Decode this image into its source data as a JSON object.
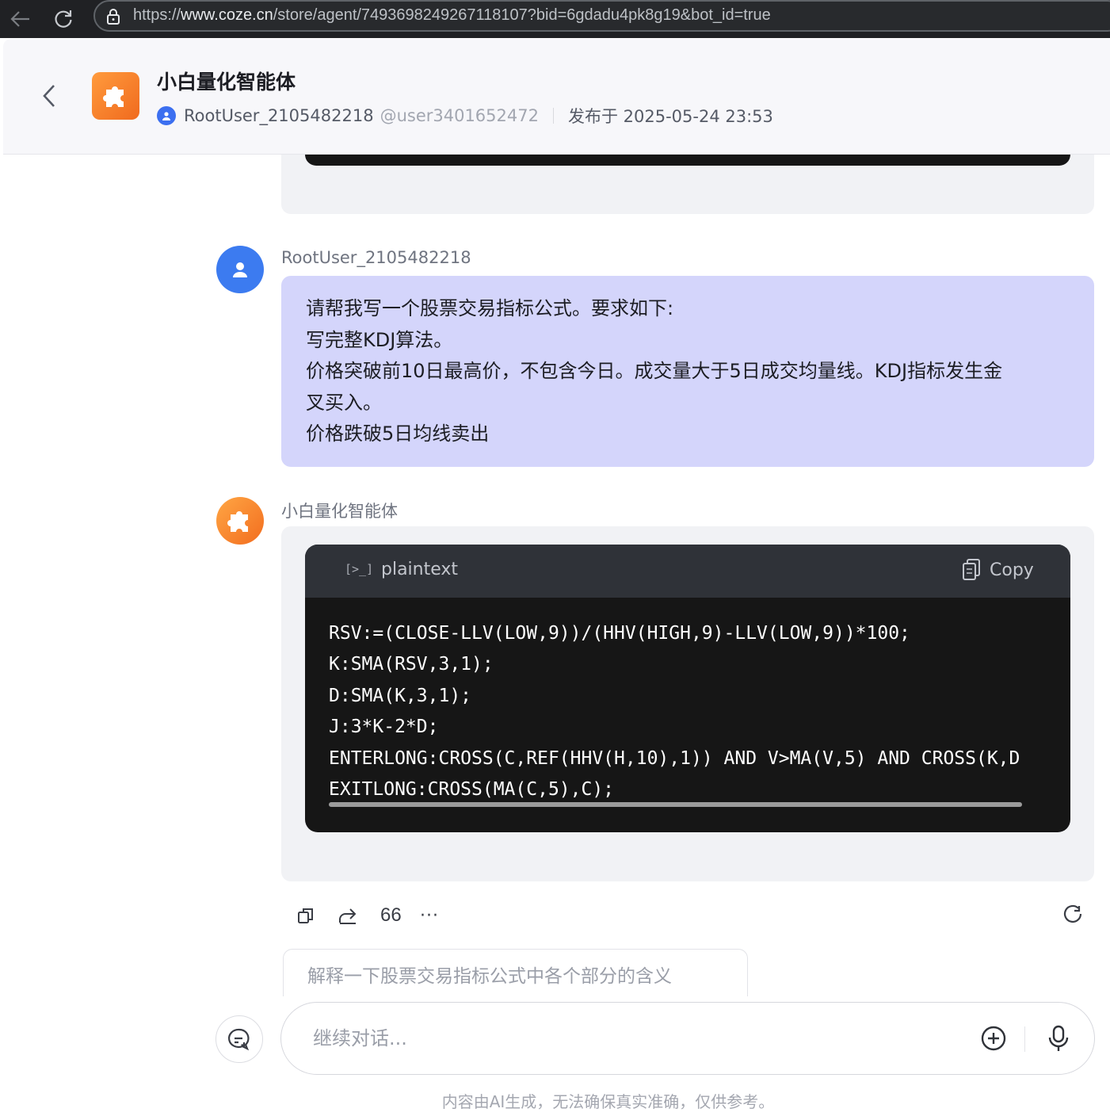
{
  "browser": {
    "url_prefix": "https://",
    "url_host": "www.coze.cn",
    "url_path": "/store/agent/7493698249267118107?bid=6gdadu4pk8g19&bot_id=true"
  },
  "header": {
    "bot_name": "小白量化智能体",
    "author": "RootUser_2105482218",
    "handle": "@user3401652472",
    "published": "发布于 2025-05-24 23:53"
  },
  "messages": {
    "user": {
      "sender": "RootUser_2105482218",
      "lines": [
        "请帮我写一个股票交易指标公式。要求如下:",
        "写完整KDJ算法。",
        "价格突破前10日最高价，不包含今日。成交量大于5日成交均量线。KDJ指标发生金",
        "叉买入。",
        "价格跌破5日均线卖出"
      ]
    },
    "bot": {
      "sender": "小白量化智能体",
      "code_lang_icon": "[>_]",
      "code_lang": "plaintext",
      "copy_label": "Copy",
      "code_lines": [
        "RSV:=(CLOSE-LLV(LOW,9))/(HHV(HIGH,9)-LLV(LOW,9))*100;",
        "K:SMA(RSV,3,1);",
        "D:SMA(K,3,1);",
        "J:3*K-2*D;",
        "ENTERLONG:CROSS(C,REF(HHV(H,10),1)) AND V>MA(V,5) AND CROSS(K,D",
        "EXITLONG:CROSS(MA(C,5),C);"
      ]
    }
  },
  "actions": {
    "quote_label": "66",
    "more_label": "···",
    "icons": [
      "copy-icon",
      "share-icon",
      "quote-icon",
      "more-icon",
      "regenerate-icon"
    ]
  },
  "suggestion": "解释一下股票交易指标公式中各个部分的含义",
  "input": {
    "placeholder": "继续对话..."
  },
  "disclaimer": "内容由AI生成，无法确保真实准确，仅供参考。",
  "colors": {
    "user_bubble": "#d4d5fb",
    "card_bg": "#f1f2f5",
    "code_bg": "#161616",
    "code_header": "#2f3238",
    "user_avatar": "#3c7bf0",
    "bot_avatar": "#f26d1f"
  }
}
